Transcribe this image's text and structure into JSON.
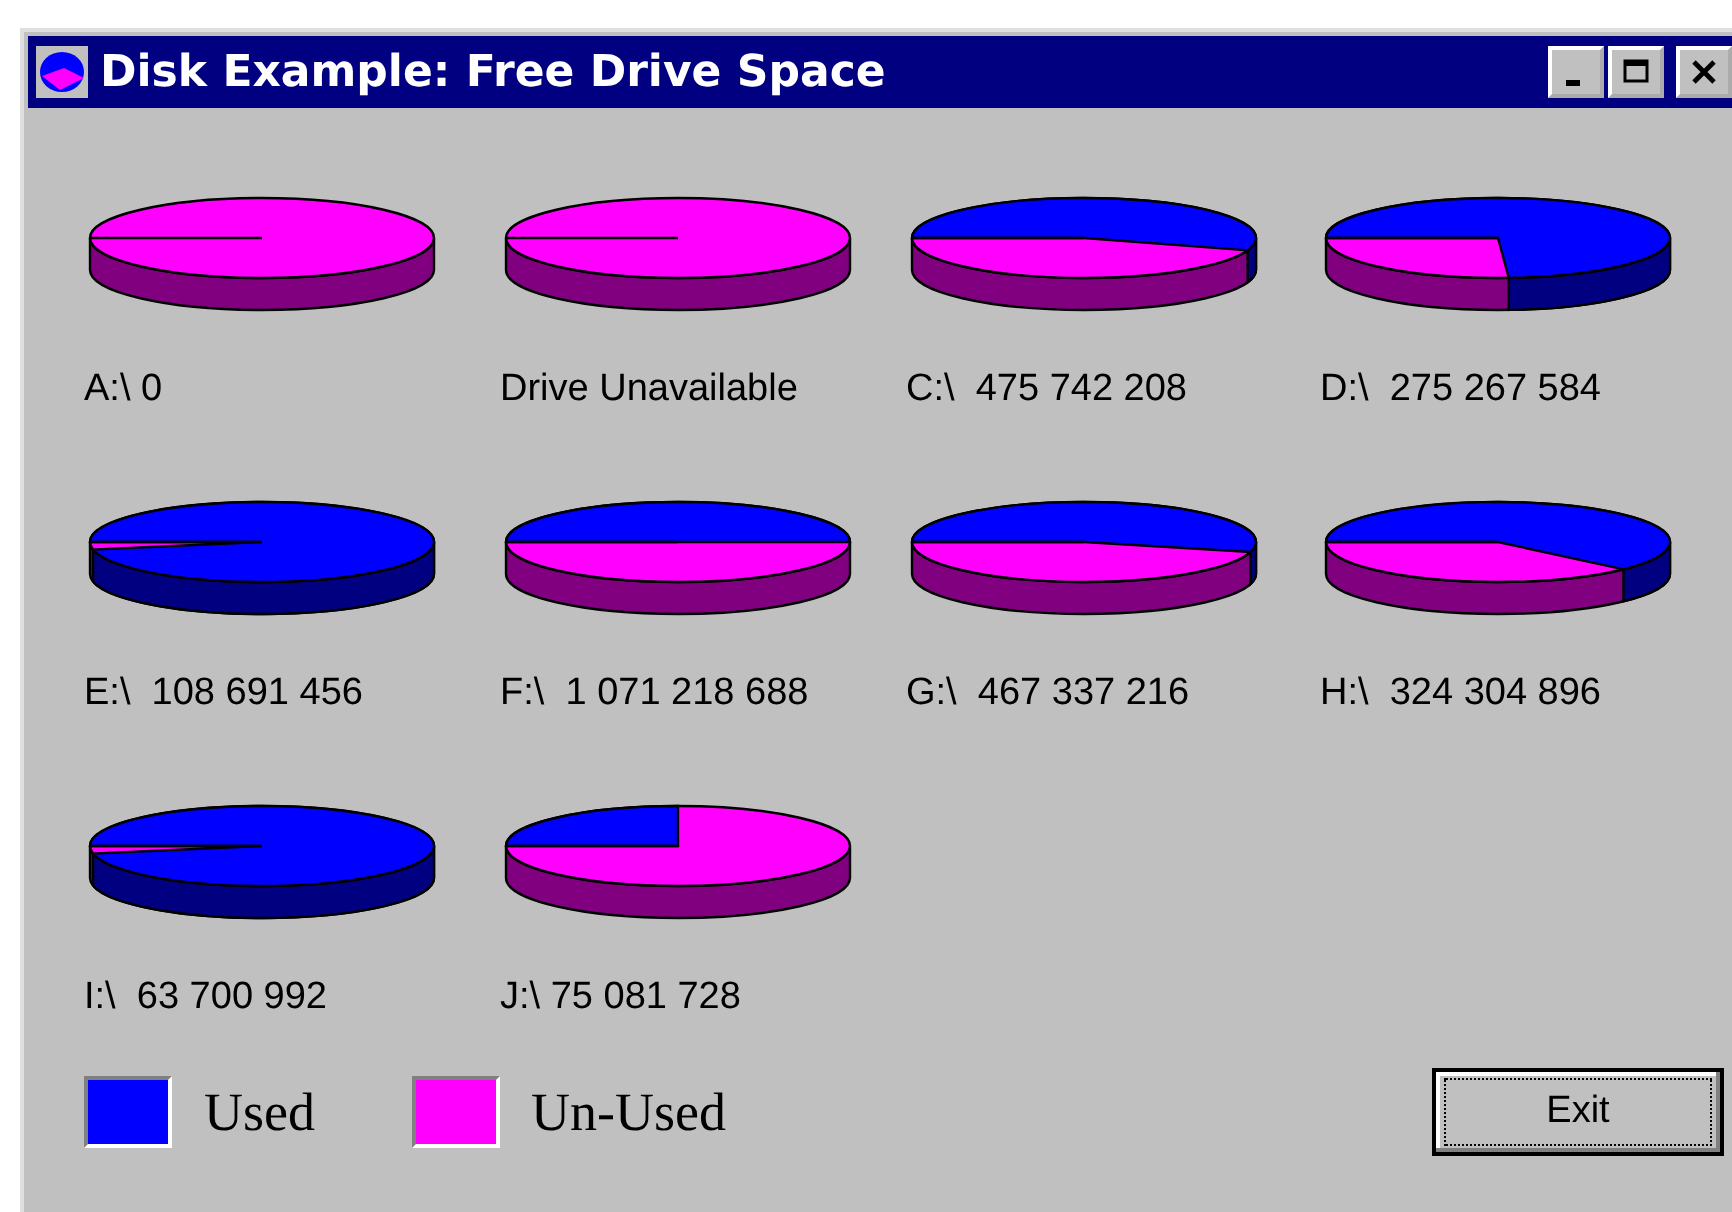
{
  "window": {
    "title": "Disk Example: Free Drive Space"
  },
  "drives": [
    {
      "label": "A:\\ 0"
    },
    {
      "label": "Drive Unavailable"
    },
    {
      "label": "C:\\  475 742 208"
    },
    {
      "label": "D:\\  275 267 584"
    },
    {
      "label": "E:\\  108 691 456"
    },
    {
      "label": "F:\\  1 071 218 688"
    },
    {
      "label": "G:\\  467 337 216"
    },
    {
      "label": "H:\\  324 304 896"
    },
    {
      "label": "I:\\  63 700 992"
    },
    {
      "label": "J:\\ 75 081 728"
    }
  ],
  "legend": [
    {
      "label": "Used",
      "color": "#0000ff"
    },
    {
      "label": "Un-Used",
      "color": "#ff00ff"
    }
  ],
  "exit_button": {
    "label": "Exit"
  }
}
